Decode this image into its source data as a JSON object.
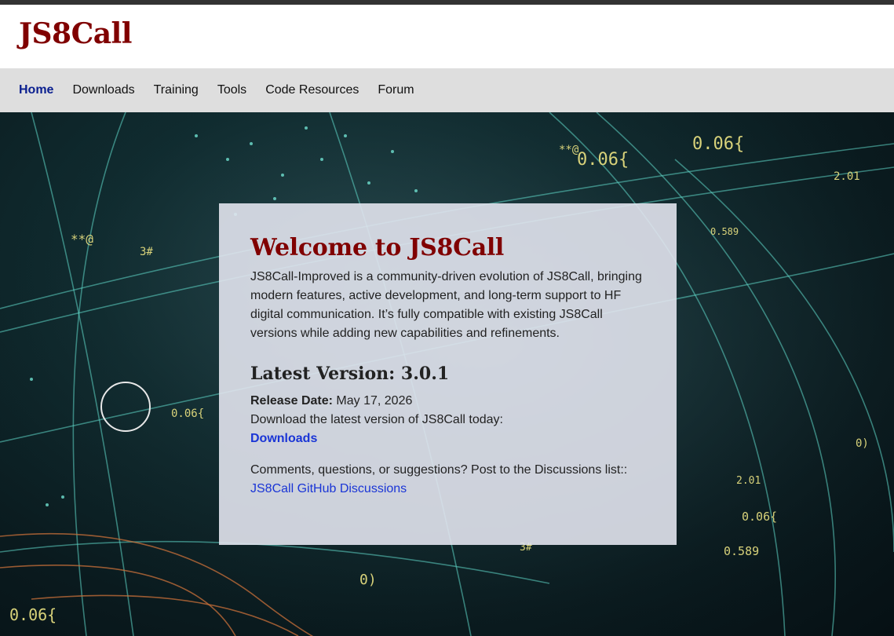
{
  "site": {
    "logo": "JS8Call"
  },
  "nav": {
    "items": [
      {
        "label": "Home",
        "active": true
      },
      {
        "label": "Downloads",
        "active": false
      },
      {
        "label": "Training",
        "active": false
      },
      {
        "label": "Tools",
        "active": false
      },
      {
        "label": "Code Resources",
        "active": false
      },
      {
        "label": "Forum",
        "active": false
      }
    ]
  },
  "hero": {
    "overlay_labels": [
      "0.06{",
      "**@",
      "0.06{",
      "2.01",
      "0.589",
      "3#",
      "**@",
      "0.06{",
      "2.01",
      "0.06{",
      "0.589",
      "3#",
      "0.06{",
      "0)",
      "0)"
    ]
  },
  "card": {
    "title": "Welcome to JS8Call",
    "intro": "JS8Call-Improved is a community-driven evolution of JS8Call, bringing modern features, active development, and long-term support to HF digital communication. It’s fully compatible with existing JS8Call versions while adding new capabilities and refinements.",
    "version_heading": "Latest Version: 3.0.1",
    "release_label": "Release Date:",
    "release_date": "May 17, 2026",
    "download_prompt": "Download the latest version of JS8Call today:",
    "downloads_link": "Downloads",
    "discussion_prompt": "Comments, questions, or suggestions? Post to the Discussions list::",
    "discussion_link": "JS8Call GitHub Discussions"
  },
  "colors": {
    "brand": "#800000",
    "link": "#1a35d6",
    "nav_active": "#0a1f8f",
    "nav_bg": "#dedede"
  }
}
